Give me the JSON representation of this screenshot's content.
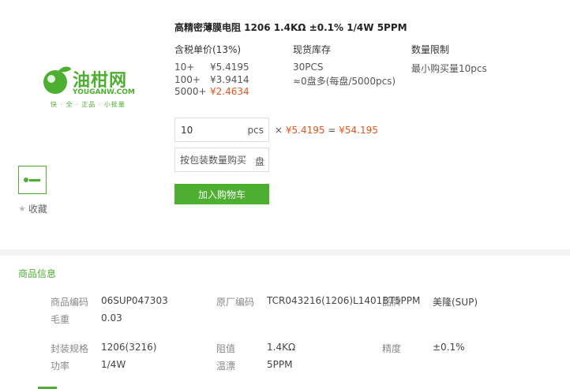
{
  "brand": {
    "name": "油柑网",
    "domain": "YOUGANW.COM",
    "slogan": "快 · 全 · 正品 · 小批量",
    "color": "#4caf2f"
  },
  "gallery": {
    "favorite_label": "收藏"
  },
  "product": {
    "title": "高精密薄膜电阻 1206 1.4KΩ ±0.1% 1/4W 5PPM"
  },
  "pricing": {
    "header": "含税单价(13%)",
    "tiers": [
      {
        "qty": "10+",
        "price": "¥5.4195"
      },
      {
        "qty": "100+",
        "price": "¥3.9414"
      },
      {
        "qty": "5000+",
        "price": "¥2.4634"
      }
    ]
  },
  "stock": {
    "header": "现货库存",
    "line1": "30PCS",
    "line2": "≈0盘多(每盘/5000pcs)"
  },
  "limit": {
    "header": "数量限制",
    "text": "最小购买量10pcs"
  },
  "order": {
    "qty_value": "10",
    "qty_unit": "pcs",
    "times": "×",
    "unit_price": "¥5.4195",
    "equals": "=",
    "total": "¥54.195",
    "pack_placeholder": "按包装数量购买",
    "pack_unit": "盘",
    "add_cart_label": "加入购物车",
    "accent_color": "#e8541c"
  },
  "info": {
    "section_title": "商品信息",
    "fields": {
      "code_label": "商品编码",
      "code_value": "06SUP047303",
      "mfr_label": "原厂编码",
      "mfr_value": "TCR043216(1206)L1401BT5PPM",
      "brand_label": "品牌",
      "brand_value": "美隆(SUP)",
      "weight_label": "毛重",
      "weight_value": "0.03",
      "package_label": "封装规格",
      "package_value": "1206(3216)",
      "resistance_label": "阻值",
      "resistance_value": "1.4KΩ",
      "accuracy_label": "精度",
      "accuracy_value": "±0.1%",
      "power_label": "功率",
      "power_value": "1/4W",
      "tempco_label": "温漂",
      "tempco_value": "5PPM"
    }
  }
}
